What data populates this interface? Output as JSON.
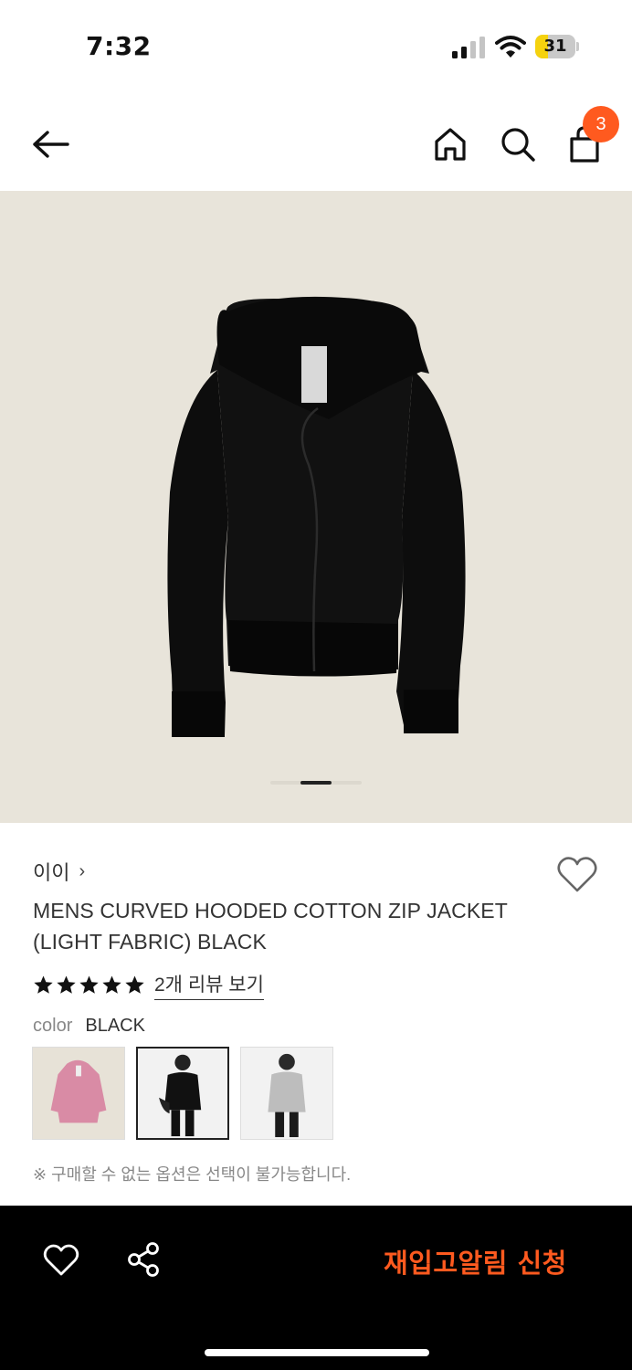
{
  "status_bar": {
    "time": "7:32",
    "battery_level": "31",
    "battery_fraction": 0.31,
    "icons": [
      "signal-icon",
      "wifi-icon",
      "battery-icon"
    ]
  },
  "header": {
    "icons": [
      "back-arrow-icon",
      "home-icon",
      "search-icon",
      "shopping-bag-icon"
    ],
    "cart_count": "3"
  },
  "product_image": {
    "background": "#e8e4da",
    "slide_index": 1
  },
  "product": {
    "brand": "이이",
    "brand_chevron": "›",
    "name": "MENS CURVED HOODED COTTON ZIP JACKET (LIGHT FABRIC) BLACK",
    "rating_stars": 5,
    "review_link": "2개 리뷰 보기",
    "color_label": "color",
    "color_value": "BLACK",
    "swatches": [
      {
        "name": "pink",
        "selected": false
      },
      {
        "name": "black",
        "selected": true
      },
      {
        "name": "grey",
        "selected": false
      }
    ],
    "notice": "※ 구매할 수 없는 옵션은 선택이 불가능합니다."
  },
  "bottom_bar": {
    "icons": [
      "heart-icon",
      "share-icon"
    ],
    "restock_button": "재입고알림 신청"
  },
  "colors": {
    "accent": "#ff5a1f",
    "bottom_bar_bg": "#000000",
    "text": "#333333"
  }
}
